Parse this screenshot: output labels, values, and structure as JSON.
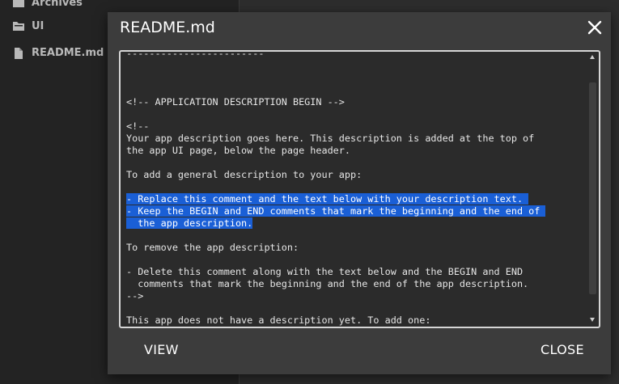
{
  "sidebar": {
    "items": [
      {
        "label": "Archives",
        "icon": "folder-icon"
      },
      {
        "label": "UI",
        "icon": "folder-icon"
      },
      {
        "label": "README.md",
        "icon": "file-icon"
      }
    ]
  },
  "dialog": {
    "title": "README.md",
    "close_icon": "close-icon",
    "buttons": {
      "view_label": "VIEW",
      "close_label": "CLOSE"
    }
  },
  "editor": {
    "lines": [
      "------------------------",
      "",
      "",
      "",
      "<!-- APPLICATION DESCRIPTION BEGIN -->",
      "",
      "<!--",
      "Your app description goes here. This description is added at the top of",
      "the app UI page, below the page header.",
      "",
      "To add a general description to your app:",
      "",
      "- Replace this comment and the text below with your description text. ",
      "- Keep the BEGIN and END comments that mark the beginning and the end of ",
      "  the app description.",
      "",
      "To remove the app description:",
      "",
      "- Delete this comment along with the text below and the BEGIN and END",
      "  comments that mark the beginning and the end of the app description.",
      "-->",
      "",
      "This app does not have a description yet. To add one:"
    ],
    "selected_lines": [
      12,
      13,
      14
    ]
  },
  "colors": {
    "selection": "#1a5fd6",
    "dialog_bg": "#3c3c3c",
    "editor_bg": "#2b2b2b"
  }
}
